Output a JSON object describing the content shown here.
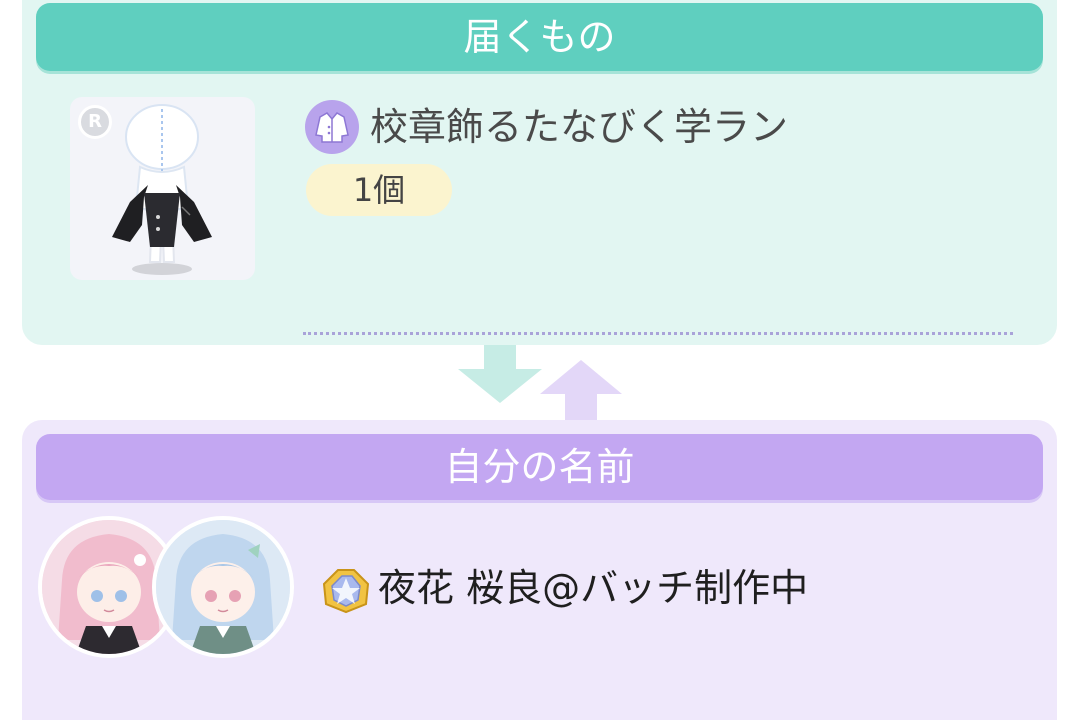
{
  "delivery": {
    "header": "届くもの",
    "item": {
      "rarity_badge": "R",
      "icon": "jacket-icon",
      "name": "校章飾るたなびく学ラン",
      "quantity": "1個"
    }
  },
  "sender": {
    "header": "自分の名前",
    "badge_icon": "gold-badge-icon",
    "name": "夜花 桜良@バッチ制作中"
  },
  "colors": {
    "teal_header": "#5fcfbf",
    "teal_panel": "#e2f6f2",
    "purple_header": "#c3a7f2",
    "purple_panel": "#efe8fb",
    "quantity_pill": "#fbf4cf"
  }
}
